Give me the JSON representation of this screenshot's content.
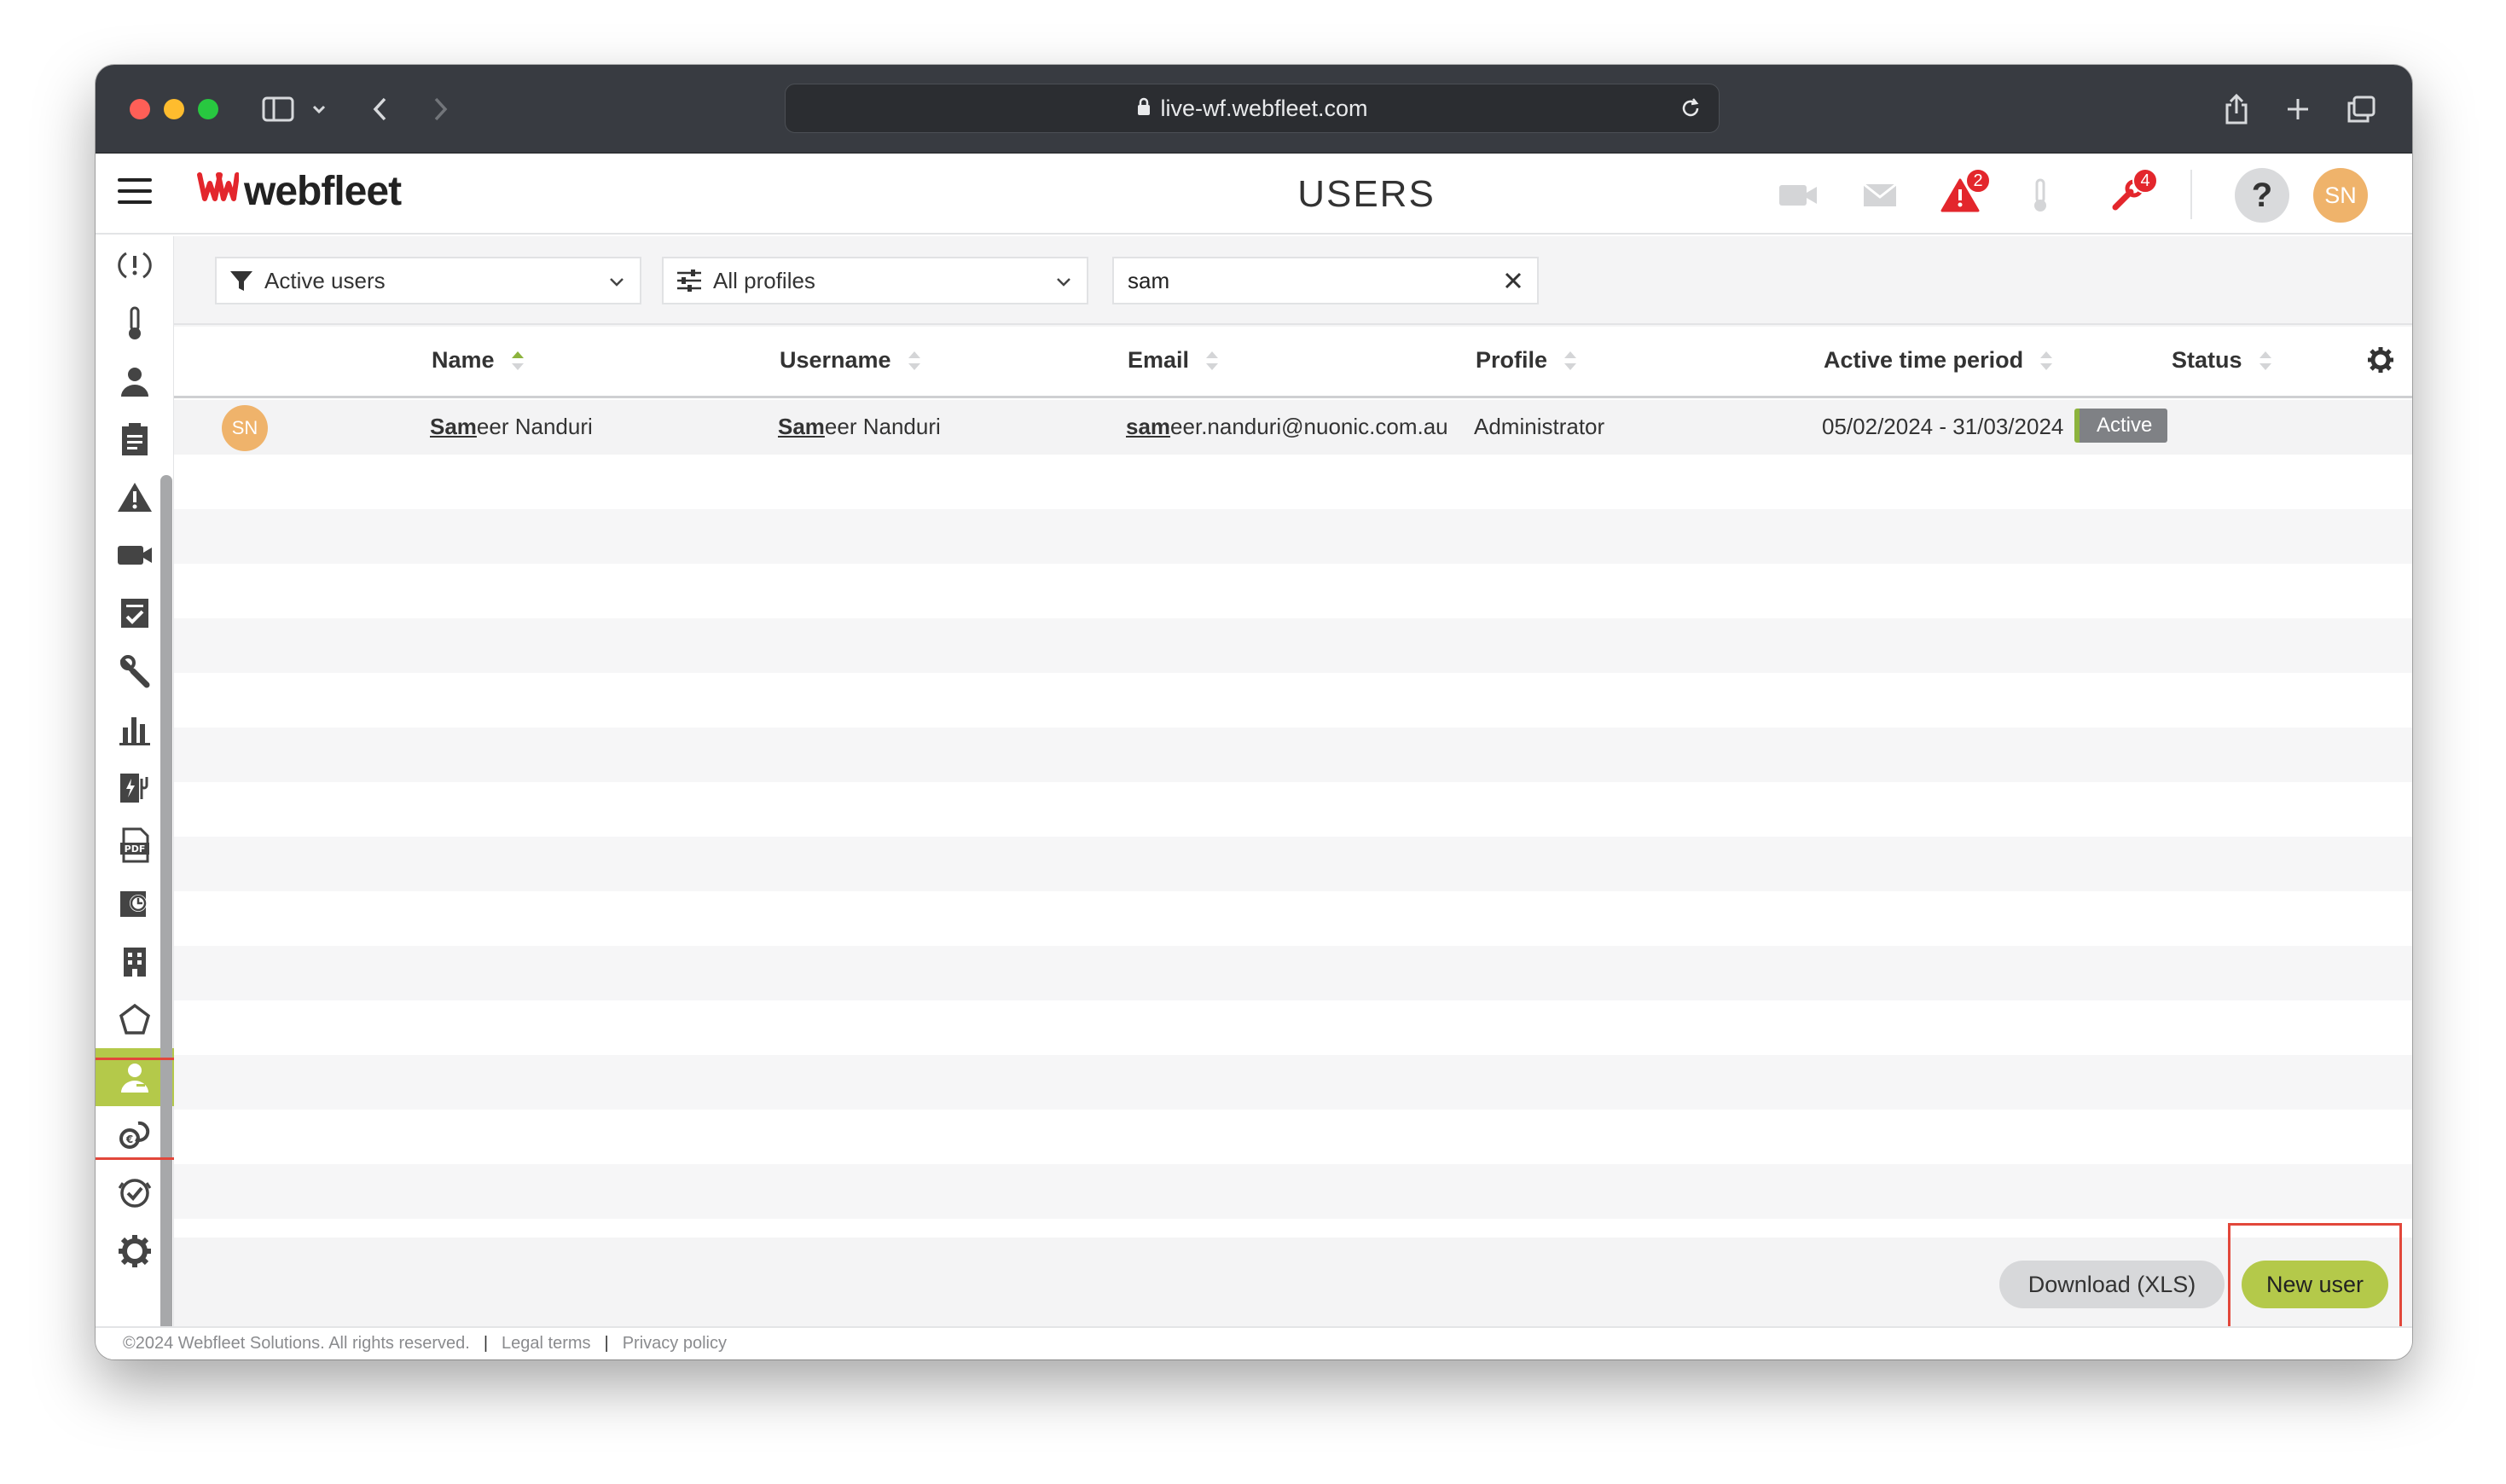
{
  "browser": {
    "url": "live-wf.webfleet.com"
  },
  "header": {
    "logo_text": "webfleet",
    "page_title": "USERS",
    "alerts_badge": "2",
    "maintenance_badge": "4",
    "help_label": "?",
    "user_initials": "SN"
  },
  "filters": {
    "status_filter": "Active users",
    "profile_filter": "All profiles",
    "search_value": "sam"
  },
  "table": {
    "columns": [
      "Name",
      "Username",
      "Email",
      "Profile",
      "Active time period",
      "Status"
    ],
    "rows": [
      {
        "initials": "SN",
        "name_match": "Sam",
        "name_rest": "eer Nanduri",
        "username_match": "Sam",
        "username_rest": "eer Nanduri",
        "email_match": "sam",
        "email_rest": "eer.nanduri@nuonic.com.au",
        "profile": "Administrator",
        "active_period": "05/02/2024 - 31/03/2024",
        "status": "Active"
      }
    ]
  },
  "actions": {
    "download_label": "Download (XLS)",
    "new_user_label": "New user"
  },
  "footer": {
    "copyright": "©2024 Webfleet Solutions. All rights reserved.",
    "legal": "Legal terms",
    "privacy": "Privacy policy"
  },
  "sidebar": {
    "items": [
      "alerts-icon",
      "temperature-icon",
      "driver-icon",
      "orders-icon",
      "warning-icon",
      "video-icon",
      "tasks-icon",
      "maintenance-icon",
      "reports-icon",
      "fuel-icon",
      "pdf-report-icon",
      "timesheet-icon",
      "building-icon",
      "geofence-icon",
      "users-icon",
      "expenses-icon",
      "checks-icon",
      "settings-icon"
    ],
    "active": "users-icon"
  },
  "colors": {
    "accent_green": "#b4c94a",
    "brand_red": "#e3262c",
    "highlight_red": "#e2473b",
    "avatar_orange": "#efb36b"
  }
}
